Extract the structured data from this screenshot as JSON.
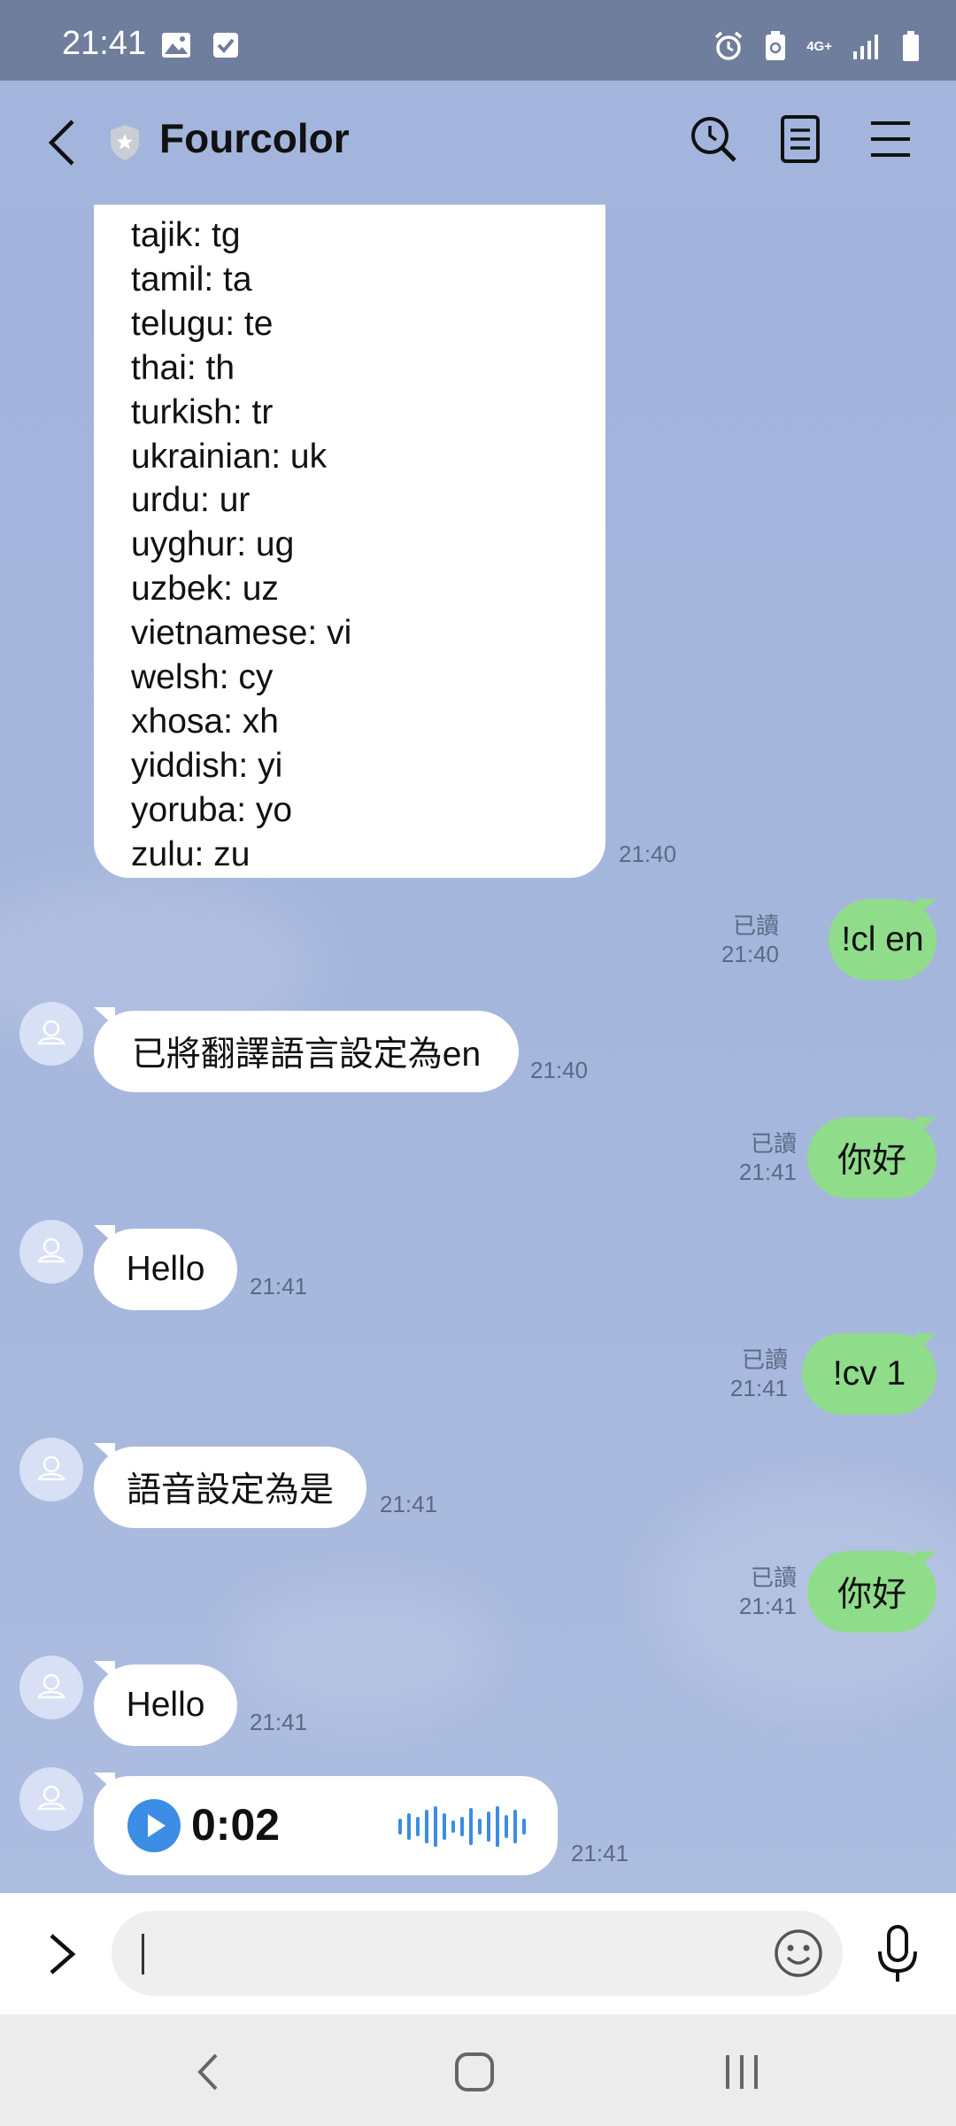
{
  "status_bar": {
    "time": "21:41",
    "network": "4G+"
  },
  "header": {
    "title": "Fourcolor"
  },
  "language_list": [
    "tajik: tg",
    "tamil: ta",
    "telugu: te",
    "thai: th",
    "turkish: tr",
    "ukrainian: uk",
    "urdu: ur",
    "uyghur: ug",
    "uzbek: uz",
    "vietnamese: vi",
    "welsh: cy",
    "xhosa: xh",
    "yiddish: yi",
    "yoruba: yo",
    "zulu: zu"
  ],
  "messages": [
    {
      "id": "m0",
      "direction": "in",
      "type": "language-list",
      "time": "21:40"
    },
    {
      "id": "m1",
      "direction": "out",
      "text": "!cl en",
      "read": "已讀",
      "time": "21:40"
    },
    {
      "id": "m2",
      "direction": "in",
      "text": "已將翻譯語言設定為en",
      "time": "21:40"
    },
    {
      "id": "m3",
      "direction": "out",
      "text": "你好",
      "read": "已讀",
      "time": "21:41"
    },
    {
      "id": "m4",
      "direction": "in",
      "text": "Hello",
      "time": "21:41"
    },
    {
      "id": "m5",
      "direction": "out",
      "text": "!cv 1",
      "read": "已讀",
      "time": "21:41"
    },
    {
      "id": "m6",
      "direction": "in",
      "text": "語音設定為是",
      "time": "21:41"
    },
    {
      "id": "m7",
      "direction": "out",
      "text": "你好",
      "read": "已讀",
      "time": "21:41"
    },
    {
      "id": "m8",
      "direction": "in",
      "text": "Hello",
      "time": "21:41"
    },
    {
      "id": "m9",
      "direction": "in",
      "type": "voice",
      "duration": "0:02",
      "time": "21:41"
    }
  ],
  "input": {
    "value": "",
    "placeholder": ""
  },
  "icons": {
    "header": [
      "back-arrow-icon",
      "shield-star-icon",
      "search-clock-icon",
      "notes-icon",
      "menu-icon"
    ],
    "input_bar": [
      "expand-chevron-icon",
      "emoji-icon",
      "microphone-icon"
    ],
    "nav_bar": [
      "nav-back-icon",
      "nav-home-icon",
      "nav-recents-icon"
    ]
  },
  "colors": {
    "chat_background": "#a3b5dc",
    "outgoing_bubble": "#8fdc8a",
    "incoming_bubble": "#ffffff",
    "voice_accent": "#3b8de5"
  }
}
